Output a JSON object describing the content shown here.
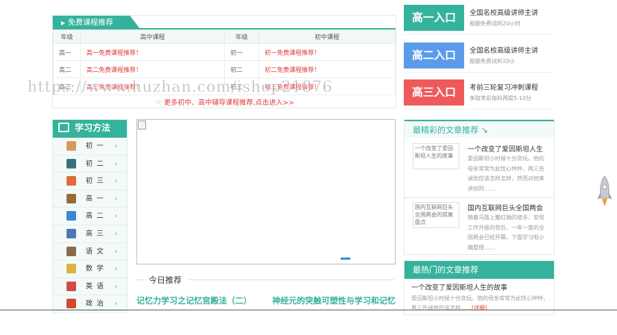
{
  "free_courses": {
    "tab_label": "免费课程推荐",
    "headers": [
      "年级",
      "高中课程",
      "年级",
      "初中课程"
    ],
    "rows": [
      {
        "hg": "高一",
        "hc": "高一免费课程推荐！",
        "jg": "初一",
        "jc": "初一免费课程推荐！"
      },
      {
        "hg": "高二",
        "hc": "高二免费课程推荐！",
        "jg": "初二",
        "jc": "初二免费课程推荐！"
      },
      {
        "hg": "高三",
        "hc": "高三免费课程推荐！",
        "jg": "初三",
        "jc": "初三免费课程推荐！"
      }
    ],
    "more": "更多初中、高中辅导课程推荐,点击进入>>"
  },
  "entries": [
    {
      "btn": "高一入口",
      "title": "全国名校高级讲师主讲",
      "sub": "报额免费试听20小时",
      "color": "#35b29b"
    },
    {
      "btn": "高二入口",
      "title": "全国名校高级讲师主讲",
      "sub": "报额免费试听20小",
      "color": "#5b9bea"
    },
    {
      "btn": "高三入口",
      "title": "考前三轮复习冲刺课程",
      "sub": "争取考前每科再提5-10分",
      "color": "#ee5a5a"
    }
  ],
  "study": {
    "title": "学习方法",
    "items": [
      {
        "label": "初一",
        "color": "#d89a5a"
      },
      {
        "label": "初二",
        "color": "#3a6f7a"
      },
      {
        "label": "初三",
        "color": "#e06a3a"
      },
      {
        "label": "高一",
        "color": "#9a6a3a"
      },
      {
        "label": "高二",
        "color": "#3a8ad0"
      },
      {
        "label": "高三",
        "color": "#4a7ab0"
      },
      {
        "label": "语文",
        "color": "#8a6a4a"
      },
      {
        "label": "数学",
        "color": "#e0b040"
      },
      {
        "label": "英语",
        "color": "#d04a4a"
      },
      {
        "label": "政治",
        "color": "#d04a2a"
      }
    ],
    "chevron": "›"
  },
  "today": {
    "title": "今日推荐",
    "links": [
      "记忆力学习之记忆宫殿法（二）",
      "神经元的突触可塑性与学习和记忆"
    ]
  },
  "best": {
    "title": "最精彩的文章推荐 ↘",
    "articles": [
      {
        "thumb": "一个改变了爱因斯坦人生的故事",
        "title": "一个改变了爱因斯坦人生",
        "desc": "爱因斯坦小时候十分贪玩。他的母亲常常为此忧心忡忡，再三告诫他应该怎样怎样，然而对他来讲如同……"
      },
      {
        "thumb": "国内互联网巨头全国两会的提案盘点",
        "title": "国内互联网巨头全国两会",
        "desc": "随着马路上戴红袖的增多、安保工作升级的背后，一年一度的全国两会已经开幕。下面学习啦小编整理……"
      }
    ]
  },
  "hot": {
    "title": "最热门的文章推荐",
    "headline": "一个改变了爱因斯坦人生的故事",
    "desc": "爱因斯坦小时候十分贪玩。他的母亲常常为此忧心忡忡，再三告诫他应该怎样……",
    "detail": "[详细]"
  },
  "watermark": "https://www.huzhan.com/ishop21876"
}
